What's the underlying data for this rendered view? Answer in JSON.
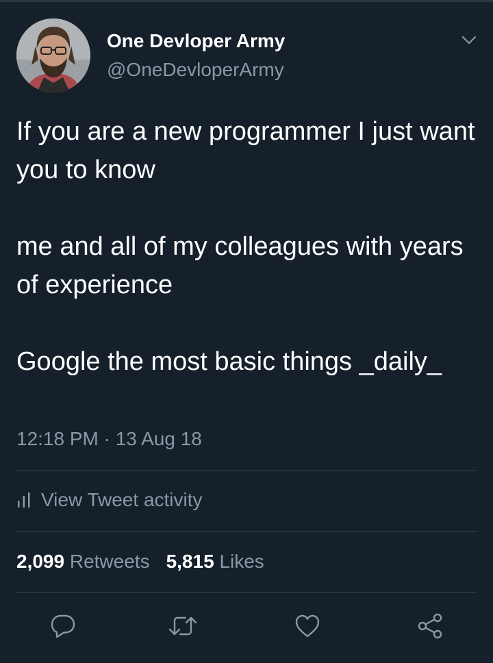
{
  "user": {
    "display_name": "One Devloper Army",
    "handle": "@OneDevloperArmy"
  },
  "tweet": {
    "paragraphs": [
      "If you are a new programmer I just want you to know",
      "me and all of my colleagues with years of experience",
      "Google the most basic things _daily_"
    ],
    "timestamp": "12:18 PM · 13 Aug 18"
  },
  "activity": {
    "label": "View Tweet activity",
    "icon": "bar-chart-icon"
  },
  "stats": {
    "retweets_count": "2,099",
    "retweets_label": "Retweets",
    "likes_count": "5,815",
    "likes_label": "Likes"
  },
  "actions": {
    "icons": [
      "reply-icon",
      "retweet-icon",
      "like-icon",
      "share-icon"
    ]
  },
  "colors": {
    "background": "#15202b",
    "text_primary": "#ffffff",
    "text_secondary": "#8899a6",
    "divider": "#38444d"
  }
}
